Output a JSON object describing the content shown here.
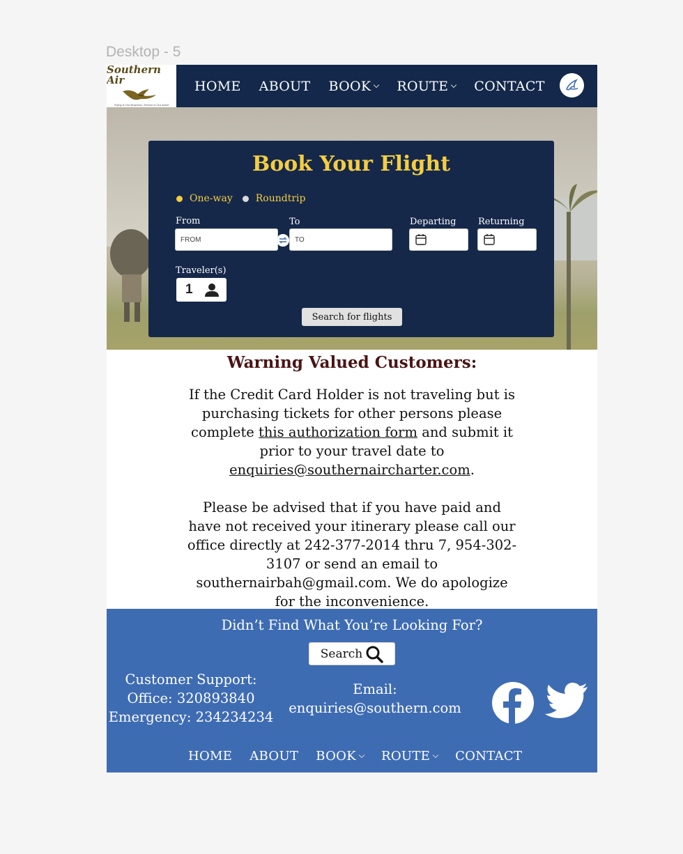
{
  "frame_label": "Desktop - 5",
  "header": {
    "logo": {
      "text": "Southern Air",
      "tagline": "Flying is Our Business, Service is Our Asset"
    },
    "nav": [
      {
        "label": "HOME"
      },
      {
        "label": "ABOUT"
      },
      {
        "label": "BOOK",
        "dropdown": true
      },
      {
        "label": "ROUTE",
        "dropdown": true
      },
      {
        "label": "CONTACT"
      }
    ],
    "profile_icon": "bird-icon"
  },
  "booking": {
    "title": "Book Your Flight",
    "trip_types": [
      {
        "label": "One-way",
        "selected": true
      },
      {
        "label": "Roundtrip",
        "selected": false
      }
    ],
    "from_label": "From",
    "from_placeholder": "FROM",
    "to_label": "To",
    "to_placeholder": "TO",
    "departing_label": "Departing",
    "returning_label": "Returning",
    "travelers_label": "Traveler(s)",
    "travelers_value": "1",
    "search_button": "Search for flights"
  },
  "warning": {
    "title": "Warning Valued Customers:",
    "p1_before": "If the Credit Card Holder is not traveling but is purchasing tickets for other persons please complete ",
    "p1_link": "this authorization form",
    "p1_middle": " and submit it prior to your travel date to ",
    "p1_email": "enquiries@southernaircharter.com",
    "p1_end": ".",
    "p2": "Please be advised that if you have paid and have not received your itinerary please call our office directly at 242-377-2014 thru 7, 954-302-3107 or send an email to southernairbah@gmail.com. We do apologize for the inconvenience."
  },
  "footer": {
    "question": "Didn’t Find What You’re Looking For?",
    "search_label": "Search",
    "support_title": "Customer Support:",
    "office": "Office: 320893840",
    "emergency": "Emergency: 234234234",
    "email_title": "Email:",
    "email": "enquiries@southern.com",
    "social": [
      "facebook-icon",
      "twitter-icon"
    ],
    "nav": [
      {
        "label": "HOME"
      },
      {
        "label": "ABOUT"
      },
      {
        "label": "BOOK",
        "dropdown": true
      },
      {
        "label": "ROUTE",
        "dropdown": true
      },
      {
        "label": "CONTACT"
      }
    ]
  },
  "colors": {
    "navy": "#13284a",
    "gold": "#f4cd41",
    "footer_blue": "#3e6cb3",
    "warning_title": "#4a1414"
  }
}
